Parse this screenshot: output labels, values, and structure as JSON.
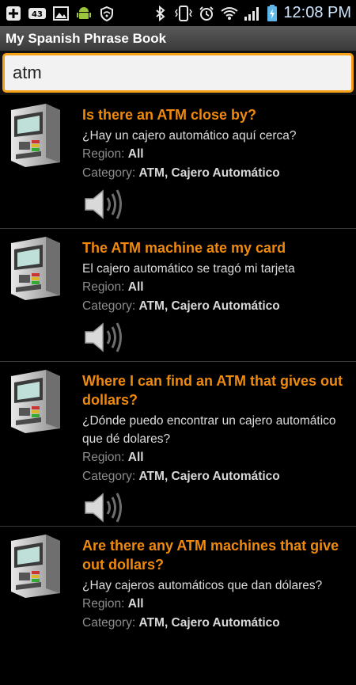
{
  "status_bar": {
    "notification_count": "43",
    "time": "12:08 PM",
    "icons_left": [
      "add-icon",
      "notification-badge-icon",
      "image-icon",
      "android-icon",
      "wifi-shield-icon"
    ],
    "icons_right": [
      "bluetooth-icon",
      "vibrate-icon",
      "alarm-icon",
      "wifi-icon",
      "signal-icon",
      "battery-charging-icon"
    ]
  },
  "app": {
    "title": "My Spanish Phrase Book"
  },
  "search": {
    "value": "atm"
  },
  "labels": {
    "region": "Region:",
    "category": "Category:"
  },
  "colors": {
    "accent": "#f08a0e",
    "search_border": "#f6a01a",
    "background": "#000000"
  },
  "results": [
    {
      "phrase": "Is there an ATM close by?",
      "translation": "¿Hay un cajero automático aquí cerca?",
      "region": "All",
      "category": "ATM, Cajero Automático",
      "icon": "atm-machine-icon"
    },
    {
      "phrase": "The ATM machine ate my card",
      "translation": "El cajero automático se tragó mi tarjeta",
      "region": "All",
      "category": "ATM, Cajero Automático",
      "icon": "atm-machine-icon"
    },
    {
      "phrase": "Where I can find an ATM that gives out dollars?",
      "translation": "¿Dónde puedo encontrar un cajero automático que dé dolares?",
      "region": "All",
      "category": "ATM, Cajero Automático",
      "icon": "atm-machine-icon"
    },
    {
      "phrase": "Are there any ATM machines that give out dollars?",
      "translation": "¿Hay cajeros automáticos que dan dólares?",
      "region": "All",
      "category": "ATM, Cajero Automático",
      "icon": "atm-machine-icon"
    }
  ]
}
